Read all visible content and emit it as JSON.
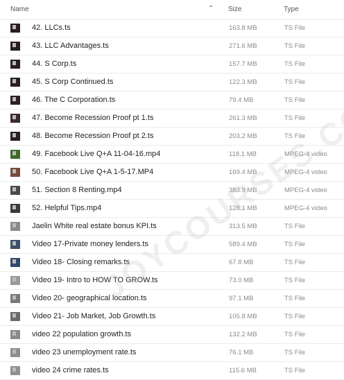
{
  "header": {
    "name": "Name",
    "size": "Size",
    "type": "Type",
    "sort_icon": "chevron-up-icon"
  },
  "rows": [
    {
      "name": "42. LLCs.ts",
      "size": "163.8 MB",
      "type": "TS File",
      "thumb": "#2b1e1e"
    },
    {
      "name": "43. LLC Advantages.ts",
      "size": "271.6 MB",
      "type": "TS File",
      "thumb": "#2a1c1f"
    },
    {
      "name": "44. S Corp.ts",
      "size": "157.7 MB",
      "type": "TS File",
      "thumb": "#2a1d1d"
    },
    {
      "name": "45. S Corp Continued.ts",
      "size": "122.3 MB",
      "type": "TS File",
      "thumb": "#2b1d1e"
    },
    {
      "name": "46. The C Corporation.ts",
      "size": "79.4 MB",
      "type": "TS File",
      "thumb": "#2c2020"
    },
    {
      "name": "47. Become Recession Proof pt 1.ts",
      "size": "261.3 MB",
      "type": "TS File",
      "thumb": "#3a2a2a"
    },
    {
      "name": "48. Become Recession Proof pt 2.ts",
      "size": "203.2 MB",
      "type": "TS File",
      "thumb": "#2a1e1e"
    },
    {
      "name": "49. Facebook Live Q+A 11-04-16.mp4",
      "size": "118.1 MB",
      "type": "MPEG-4 video",
      "thumb": "#3f6a2a"
    },
    {
      "name": "50. Facebook Live Q+A 1-5-17.MP4",
      "size": "169.4 MB",
      "type": "MPEG-4 video",
      "thumb": "#7a4a3a"
    },
    {
      "name": "51. Section 8 Renting.mp4",
      "size": "383.9 MB",
      "type": "MPEG-4 video",
      "thumb": "#4a4a4a"
    },
    {
      "name": "52. Helpful Tips.mp4",
      "size": "128.1 MB",
      "type": "MPEG-4 video",
      "thumb": "#3a3a3a"
    },
    {
      "name": "Jaelin White real estate bonus KPI.ts",
      "size": "313.5 MB",
      "type": "TS File",
      "thumb": "#8a8a8a"
    },
    {
      "name": "Video 17-Private money lenders.ts",
      "size": "589.4 MB",
      "type": "TS File",
      "thumb": "#3c4f6a"
    },
    {
      "name": "Video 18- Closing remarks.ts",
      "size": "67.8 MB",
      "type": "TS File",
      "thumb": "#2f4a6a"
    },
    {
      "name": "Video 19- Intro to HOW TO GROW.ts",
      "size": "73.0 MB",
      "type": "TS File",
      "thumb": "#9a9a9a"
    },
    {
      "name": "Video 20- geographical location.ts",
      "size": "97.1 MB",
      "type": "TS File",
      "thumb": "#7a7a7a"
    },
    {
      "name": "Video 21- Job Market, Job Growth.ts",
      "size": "105.8 MB",
      "type": "TS File",
      "thumb": "#6a6a6a"
    },
    {
      "name": "video 22 population growth.ts",
      "size": "132.2 MB",
      "type": "TS File",
      "thumb": "#8a8a8a"
    },
    {
      "name": "video 23 unemployment rate.ts",
      "size": "76.1 MB",
      "type": "TS File",
      "thumb": "#8f8f8f"
    },
    {
      "name": "video 24 crime rates.ts",
      "size": "115.6 MB",
      "type": "TS File",
      "thumb": "#909090"
    }
  ],
  "watermark": "JOYCOURSES.COM"
}
